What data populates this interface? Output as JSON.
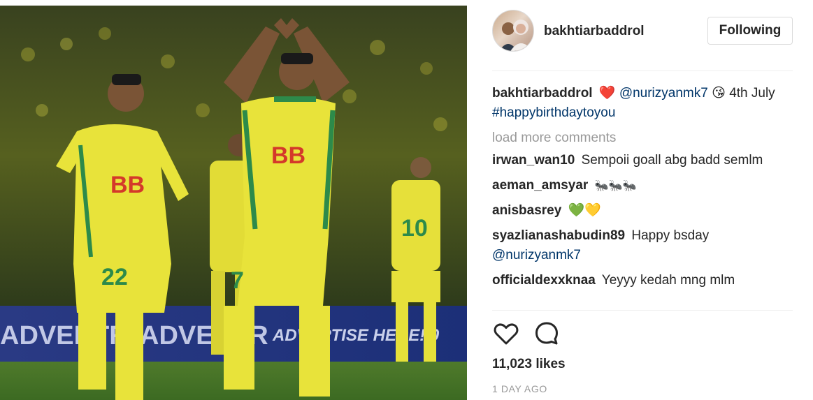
{
  "post": {
    "username": "bakhtiarbaddrol",
    "follow_label": "Following",
    "caption": {
      "user": "bakhtiarbaddrol",
      "heart": "❤️",
      "mention": "@nurizyanmk7",
      "emoji": "😘",
      "text_after": "4th July",
      "hashtag": "#happybirthdaytoyou"
    },
    "load_more_label": "load more comments",
    "comments": [
      {
        "user": "irwan_wan10",
        "text": "Sempoii goall abg badd semlm"
      },
      {
        "user": "aeman_amsyar",
        "text": "🐜🐜🐜"
      },
      {
        "user": "anisbasrey",
        "text": "💚💛"
      },
      {
        "user": "syazlianashabudin89",
        "text": "Happy bsday",
        "mention": "@nurizyanmk7"
      },
      {
        "user": "officialdexxknaa",
        "text": "Yeyyy kedah mng mlm"
      }
    ],
    "likes_text": "11,023 likes",
    "time_ago": "1 DAY AGO"
  },
  "photo": {
    "sponsor_logo": "BB",
    "jersey_numbers": [
      "22",
      "7",
      "10"
    ],
    "banner_text": [
      "ADVENTR",
      "ADVENTR",
      "ADVERTISE HERE! 0"
    ]
  },
  "icons": {
    "like": "heart-outline-icon",
    "comment": "comment-bubble-icon"
  },
  "colors": {
    "link": "#003569",
    "muted": "#999999",
    "border": "#dbdbdb",
    "jersey_yellow": "#e8e33a",
    "jersey_green": "#2d8a4a"
  }
}
